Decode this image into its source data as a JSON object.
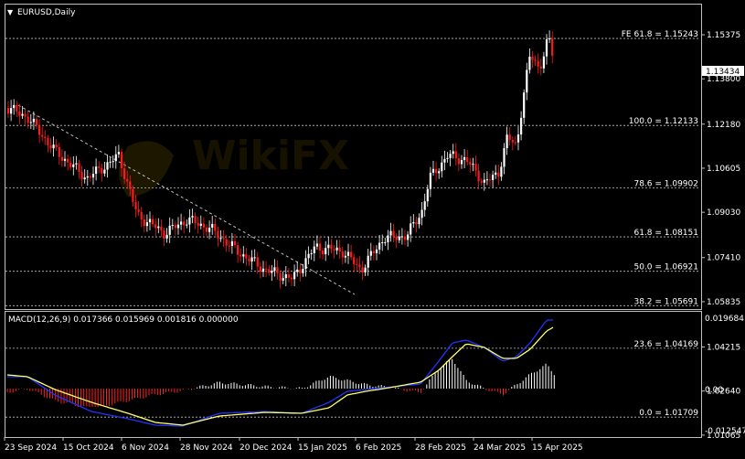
{
  "window": {
    "title": "EURUSD,Daily"
  },
  "price_panel": {
    "price_ticks": [
      "1.15375",
      "1.13800",
      "1.12180",
      "1.10605",
      "1.09030",
      "1.07410",
      "1.05835",
      "1.04215",
      "1.02640",
      "1.01065"
    ],
    "current_price": "1.13434",
    "fib_levels": [
      {
        "label": "FE 61.8 = 1.15243",
        "value": 1.15243
      },
      {
        "label": "100.0 = 1.12133",
        "value": 1.12133
      },
      {
        "label": "78.6 = 1.09902",
        "value": 1.09902
      },
      {
        "label": "61.8 = 1.08151",
        "value": 1.08151
      },
      {
        "label": "50.0 = 1.06921",
        "value": 1.06921
      },
      {
        "label": "38.2 = 1.05691",
        "value": 1.05691
      },
      {
        "label": "23.6 = 1.04169",
        "value": 1.04169
      },
      {
        "label": "0.0 = 1.01709",
        "value": 1.01709
      }
    ]
  },
  "macd_panel": {
    "title": "MACD(12,26,9) 0.017366 0.015969 0.001816 0.000000",
    "ticks": [
      "0.019684",
      "0.00",
      "-0.012547"
    ]
  },
  "time_axis": {
    "labels": [
      "23 Sep 2024",
      "15 Oct 2024",
      "6 Nov 2024",
      "28 Nov 2024",
      "20 Dec 2024",
      "15 Jan 2025",
      "6 Feb 2025",
      "28 Feb 2025",
      "24 Mar 2025",
      "15 Apr 2025"
    ]
  },
  "colors": {
    "background": "#000000",
    "up_candle": "#ffffff",
    "down_candle": "#ff1a1a",
    "grid": "#c0c0c0",
    "macd_line": "#2233ff",
    "signal_line": "#ffff66",
    "hist_up": "#ffffff",
    "hist_down": "#ff2020"
  }
}
